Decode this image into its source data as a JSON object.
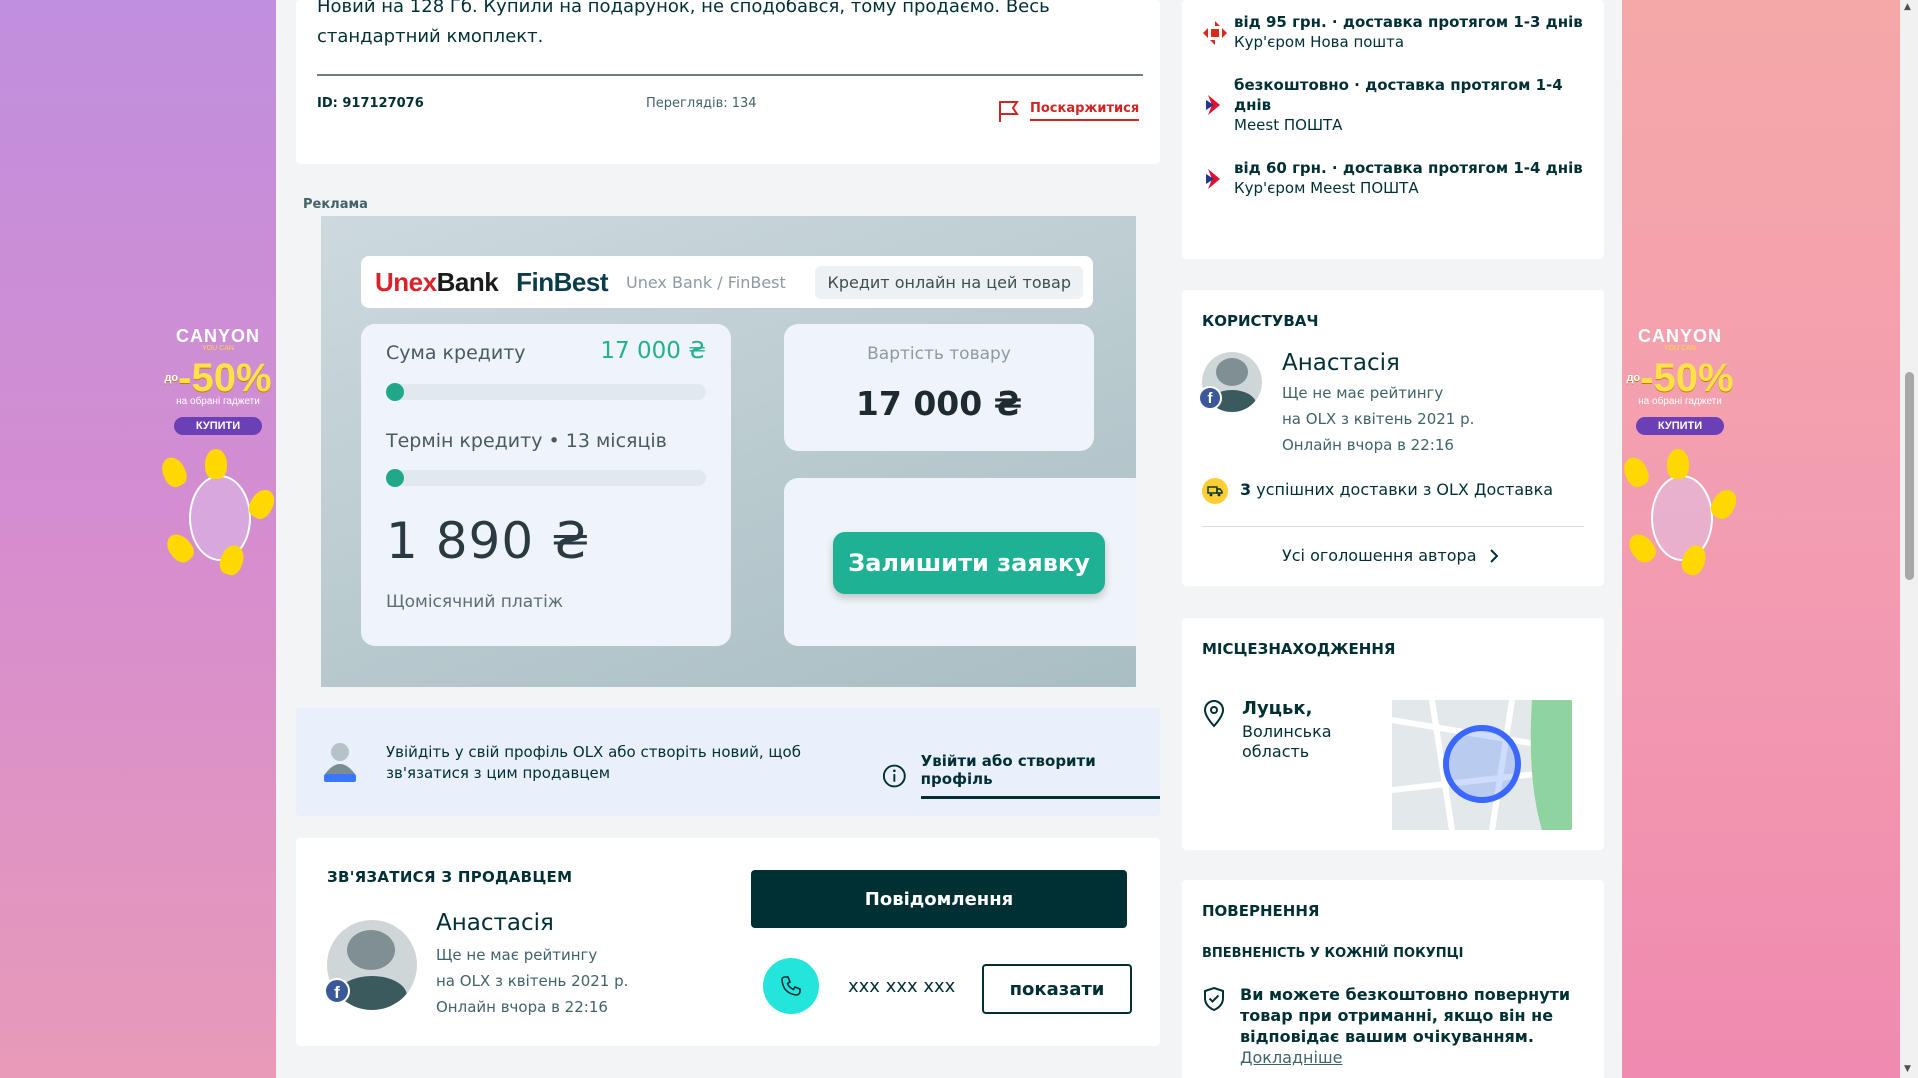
{
  "listing": {
    "description": "Новий на 128 Гб. Купили на подарунок, не сподобався, тому продаємо. Весь стандартний кмоплект.",
    "id_label": "ID: 917127076",
    "views_label": "Переглядів: 134",
    "report_label": "Поскаржитися"
  },
  "ad_label": "Реклама",
  "side_ad": {
    "brand": "CANYON",
    "brand_sub": "YOU CAN",
    "promo_prefix": "до",
    "promo": "-50%",
    "promo_sub": "на обрані гаджети",
    "buy": "КУПИТИ"
  },
  "credit": {
    "logo_unex_1": "Unex",
    "logo_unex_2": "Bank",
    "logo_fin": "FinBest",
    "brands": "Unex Bank / FinBest",
    "chip": "Кредит онлайн на цей товар",
    "sum_label": "Сума кредиту",
    "sum_value": "17 000 ₴",
    "sum_slider_fraction": 0.0,
    "term_label": "Термін кредиту • 13 місяців",
    "term_slider_fraction": 0.0,
    "monthly_value": "1 890 ₴",
    "monthly_caption": "Щомісячний платіж",
    "price_label": "Вартість товару",
    "price_value": "17 000 ₴",
    "apply_button": "Залишити заявку",
    "accent_color": "#1fb193"
  },
  "login_prompt": {
    "text": "Увійдіть у свій профіль OLX або створіть новий, щоб зв'язатися з цим продавцем",
    "link": "Увійти або створити профіль"
  },
  "contact": {
    "title": "ЗВ'ЯЗАТИСЯ З ПРОДАВЦЕМ",
    "name": "Анастасія",
    "rating": "Ще не має рейтингу",
    "since": "на OLX з квітень 2021 р.",
    "online": "Онлайн вчора в 22:16",
    "message_button": "Повідомлення",
    "phone_masked": "xxx xxx xxx",
    "show_button": "показати"
  },
  "delivery": {
    "items": [
      {
        "title": "від 95 грн. · доставка протягом 1-3 днів",
        "carrier": "Кур'єром Нова пошта",
        "icon": "nova-poshta-icon"
      },
      {
        "title": "безкоштовно · доставка протягом 1-4 днів",
        "carrier": "Meest ПОШТА",
        "icon": "meest-icon"
      },
      {
        "title": "від 60 грн. · доставка протягом 1-4 днів",
        "carrier": "Кур'єром Meest ПОШТА",
        "icon": "meest-icon"
      }
    ]
  },
  "user": {
    "title": "КОРИСТУВАЧ",
    "name": "Анастасія",
    "rating": "Ще не має рейтингу",
    "since": "на OLX з квітень 2021 р.",
    "online": "Онлайн вчора в 22:16",
    "deliveries_count": "3",
    "deliveries_text": "успішних доставки з OLX Доставка",
    "all_ads": "Усі оголошення автора"
  },
  "location": {
    "title": "МІСЦЕЗНАХОДЖЕННЯ",
    "city": "Луцьк,",
    "region_line1": "Волинська",
    "region_line2": "область"
  },
  "returns": {
    "title": "ПОВЕРНЕННЯ",
    "subtitle": "ВПЕВНЕНІСТЬ У КОЖНІЙ ПОКУПЦІ",
    "text": "Ви можете безкоштовно повернути товар при отриманні, якщо він не відповідає вашим очікуванням.",
    "more": "Докладніше"
  }
}
